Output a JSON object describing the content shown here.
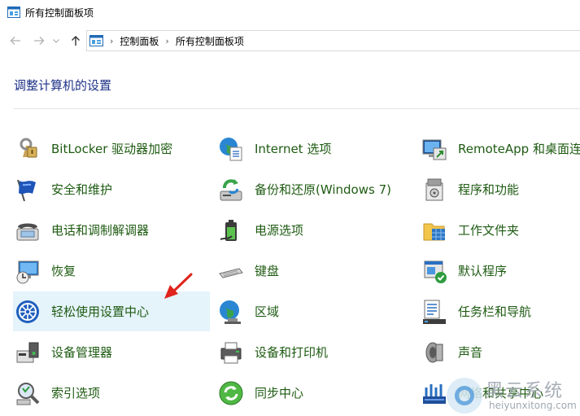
{
  "window": {
    "title": "所有控制面板项",
    "icon": "control-panel-icon"
  },
  "nav": {
    "back_icon": "back-arrow-icon",
    "forward_icon": "forward-arrow-icon",
    "recent_icon": "chevron-down-icon",
    "up_icon": "up-arrow-icon"
  },
  "address": {
    "breadcrumbs": [
      "控制面板",
      "所有控制面板项"
    ],
    "separator": "›"
  },
  "main": {
    "heading": "调整计算机的设置",
    "items": [
      {
        "label": "BitLocker 驱动器加密",
        "icon": "bitlocker-key-icon"
      },
      {
        "label": "Internet 选项",
        "icon": "internet-options-globe-icon"
      },
      {
        "label": "RemoteApp 和桌面连接",
        "icon": "remoteapp-icon"
      },
      {
        "label": "安全和维护",
        "icon": "security-flag-icon"
      },
      {
        "label": "备份和还原(Windows 7)",
        "icon": "backup-restore-icon"
      },
      {
        "label": "程序和功能",
        "icon": "programs-features-icon"
      },
      {
        "label": "电话和调制解调器",
        "icon": "phone-modem-icon"
      },
      {
        "label": "电源选项",
        "icon": "power-options-icon"
      },
      {
        "label": "工作文件夹",
        "icon": "work-folders-icon"
      },
      {
        "label": "恢复",
        "icon": "recovery-icon"
      },
      {
        "label": "键盘",
        "icon": "keyboard-icon"
      },
      {
        "label": "默认程序",
        "icon": "default-programs-icon"
      },
      {
        "label": "轻松使用设置中心",
        "icon": "ease-of-access-icon"
      },
      {
        "label": "区域",
        "icon": "region-globe-icon"
      },
      {
        "label": "任务栏和导航",
        "icon": "taskbar-navigation-icon"
      },
      {
        "label": "设备管理器",
        "icon": "device-manager-icon"
      },
      {
        "label": "设备和打印机",
        "icon": "devices-printers-icon"
      },
      {
        "label": "声音",
        "icon": "sound-speaker-icon"
      },
      {
        "label": "索引选项",
        "icon": "indexing-options-icon"
      },
      {
        "label": "同步中心",
        "icon": "sync-center-icon"
      },
      {
        "label": "网络和共享中心",
        "icon": "network-sharing-icon"
      }
    ],
    "selected_item": "轻松使用设置中心"
  },
  "annotation": {
    "arrow_color": "#e0231b"
  },
  "watermark": {
    "title": "黑云系统",
    "url": "heiyunxitong.com"
  },
  "colors": {
    "link_green": "#1e5b12",
    "heading_blue": "#1e3287",
    "selected_bg": "#e5f3fb"
  }
}
